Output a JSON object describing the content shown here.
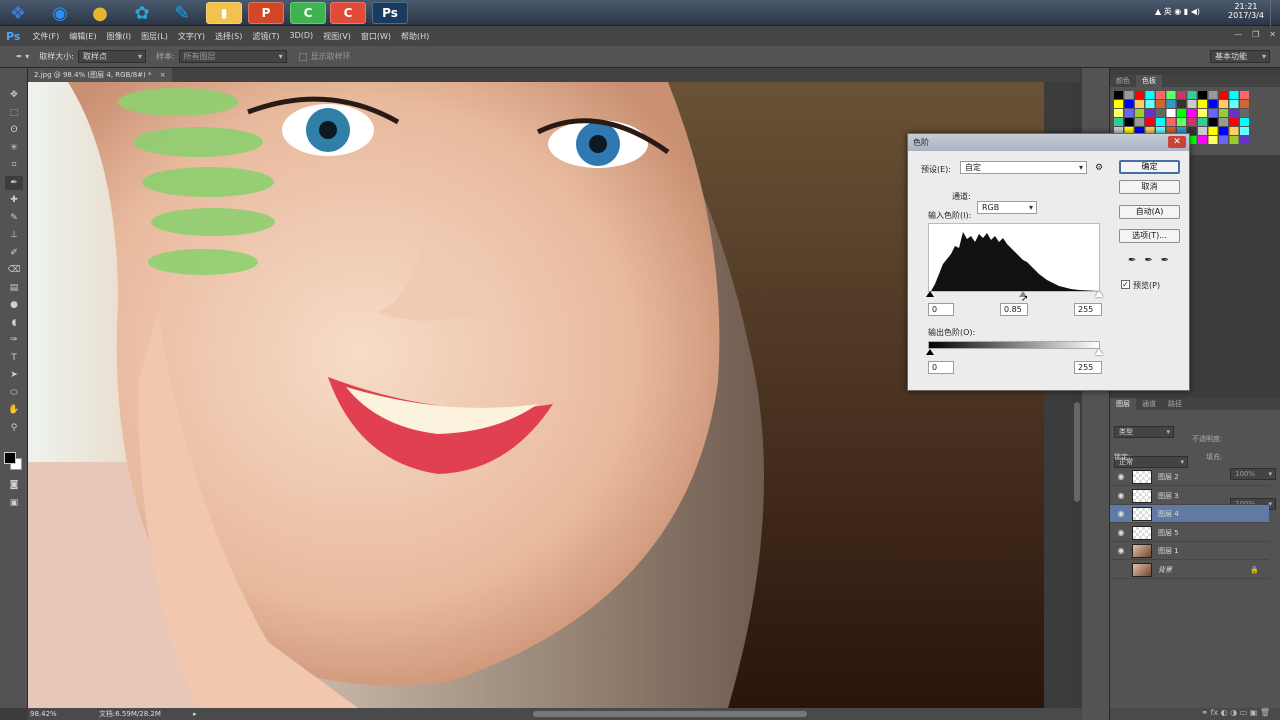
{
  "taskbar": {
    "apps": [
      {
        "name": "start",
        "glyph": "❖",
        "color": "#3a7bd5"
      },
      {
        "name": "ie",
        "glyph": "◉",
        "color": "#2d8ef0"
      },
      {
        "name": "chrome",
        "glyph": "●",
        "color": "#e6b431"
      },
      {
        "name": "qq-browser",
        "glyph": "✿",
        "color": "#25a9e0"
      },
      {
        "name": "feather",
        "glyph": "✎",
        "color": "#1aa3e8"
      },
      {
        "name": "folder",
        "glyph": "▮",
        "color": "#f2c14e"
      },
      {
        "name": "powerpoint",
        "glyph": "P",
        "color": "#d24726"
      },
      {
        "name": "camtasia-green",
        "glyph": "C",
        "color": "#3fb34f"
      },
      {
        "name": "camtasia-red",
        "glyph": "C",
        "color": "#e04b3a"
      },
      {
        "name": "photoshop",
        "glyph": "Ps",
        "color": "#1a3b5e"
      }
    ],
    "tray": {
      "lang": "英",
      "time": "21:21",
      "date": "2017/3/4"
    }
  },
  "menubar": {
    "logo": "Ps",
    "items": [
      "文件(F)",
      "编辑(E)",
      "图像(I)",
      "图层(L)",
      "文字(Y)",
      "选择(S)",
      "滤镜(T)",
      "3D(D)",
      "视图(V)",
      "窗口(W)",
      "帮助(H)"
    ],
    "window_controls": [
      "—",
      "❐",
      "✕"
    ]
  },
  "options": {
    "sample_size_label": "取样大小:",
    "sample_size_value": "取样点",
    "sample_label": "样本:",
    "sample_value": "所有图层",
    "show_ring_label": "显示取样环",
    "workspace": "基本功能"
  },
  "document": {
    "tab_title": "2.jpg @ 98.4% (图层 4, RGB/8#) *",
    "zoom": "98.42%",
    "doc_info": "文档:6.59M/28.2M"
  },
  "swatches": {
    "tabs": [
      "颜色",
      "色板"
    ]
  },
  "layers": {
    "tabs": [
      "图层",
      "通道",
      "路径"
    ],
    "filter": "类型",
    "blend_mode": "正常",
    "opacity_label": "不透明度:",
    "opacity": "100%",
    "lock_label": "锁定:",
    "fill_label": "填充:",
    "fill": "100%",
    "rows": [
      {
        "name": "图层 2",
        "thumb": "transparent",
        "selected": false
      },
      {
        "name": "图层 3",
        "thumb": "transparent",
        "selected": false
      },
      {
        "name": "图层 4",
        "thumb": "transparent",
        "selected": true
      },
      {
        "name": "图层 5",
        "thumb": "transparent",
        "selected": false
      },
      {
        "name": "图层 1",
        "thumb": "photo",
        "selected": false
      },
      {
        "name": "背景",
        "thumb": "photo",
        "selected": false,
        "locked": true
      }
    ]
  },
  "levels_dialog": {
    "title": "色阶",
    "preset_label": "预设(E):",
    "preset_value": "自定",
    "channel_label": "通道:",
    "channel_value": "RGB",
    "input_label": "输入色阶(I):",
    "input_black": "0",
    "input_gamma": "0.85",
    "input_white": "255",
    "output_label": "输出色阶(O):",
    "output_black": "0",
    "output_white": "255",
    "ok": "确定",
    "cancel": "取消",
    "auto": "自动(A)",
    "options": "选项(T)...",
    "preview": "预览(P)",
    "preview_checked": true
  }
}
